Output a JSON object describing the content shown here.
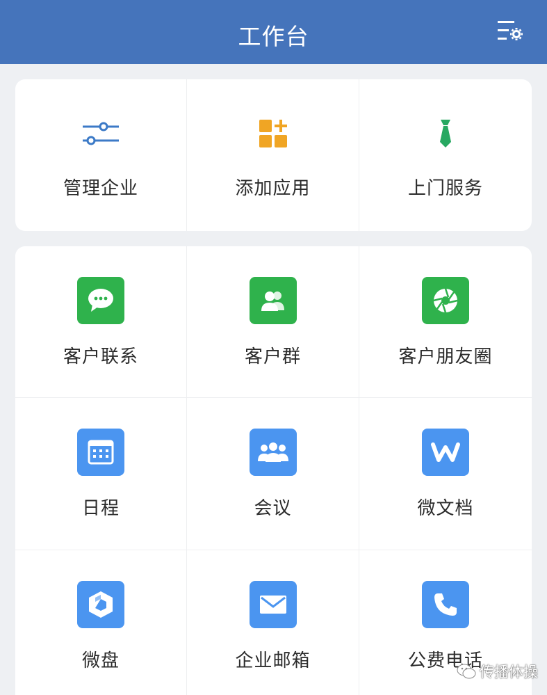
{
  "header": {
    "title": "工作台",
    "settings_icon": "list-settings-icon"
  },
  "quick_actions": [
    {
      "label": "管理企业",
      "icon": "sliders-icon",
      "color": "#3c7ac7"
    },
    {
      "label": "添加应用",
      "icon": "add-app-icon",
      "color": "#f0a524"
    },
    {
      "label": "上门服务",
      "icon": "necktie-icon",
      "color": "#27a861"
    }
  ],
  "apps": [
    {
      "label": "客户联系",
      "icon": "chat-bubble-icon",
      "color": "#2fb24c"
    },
    {
      "label": "客户群",
      "icon": "customer-group-icon",
      "color": "#2fb24c"
    },
    {
      "label": "客户朋友圈",
      "icon": "aperture-icon",
      "color": "#2fb24c"
    },
    {
      "label": "日程",
      "icon": "calendar-icon",
      "color": "#4b95f0"
    },
    {
      "label": "会议",
      "icon": "meeting-people-icon",
      "color": "#4b95f0"
    },
    {
      "label": "微文档",
      "icon": "document-w-icon",
      "color": "#4b95f0"
    },
    {
      "label": "微盘",
      "icon": "drive-icon",
      "color": "#4b95f0"
    },
    {
      "label": "企业邮箱",
      "icon": "mail-icon",
      "color": "#4b95f0"
    },
    {
      "label": "公费电话",
      "icon": "phone-icon",
      "color": "#4b95f0"
    }
  ],
  "watermark": {
    "text": "传播体操"
  }
}
